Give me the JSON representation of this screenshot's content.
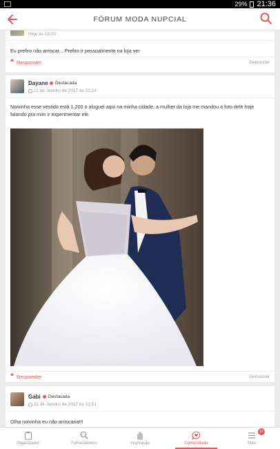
{
  "status": {
    "battery": "29%",
    "time": "21:36"
  },
  "appbar": {
    "title": "FÓRUM MODA NUPCIAL"
  },
  "posts": [
    {
      "time": "Hoje às 19:20",
      "text": "Eu prefiro não arriscar... Prefiro ir pessoalmente na loja ver",
      "reply": "Responder",
      "report": "Denunciar"
    },
    {
      "user": "Dayane",
      "badge": "Destacada",
      "date": "11 de Janeiro de 2017 às 22:14",
      "text_line1": "Noivinha esse vestido está 1.200 o aluguel aqui na minha cidade, a mulher da loja me mandou a foto dele hoje",
      "text_line2": "falando pra mim ir experimentar ele.",
      "reply": "Responder",
      "report": "Denunciar"
    },
    {
      "user": "Gabi",
      "badge": "Destacada",
      "date": "11 de Janeiro de 2017 às 21:51",
      "text": "Olha noivinha eu não arriscaria!!!"
    }
  ],
  "nav": {
    "items": [
      {
        "label": "Organizador",
        "icon": "clipboard-icon"
      },
      {
        "label": "Fornecedores",
        "icon": "search-icon"
      },
      {
        "label": "Inspiração",
        "icon": "hand-icon"
      },
      {
        "label": "Comunidade",
        "icon": "chat-heart-icon"
      },
      {
        "label": "Mais",
        "icon": "menu-icon"
      }
    ],
    "badge": "10"
  },
  "colors": {
    "accent": "#e05a5a"
  }
}
